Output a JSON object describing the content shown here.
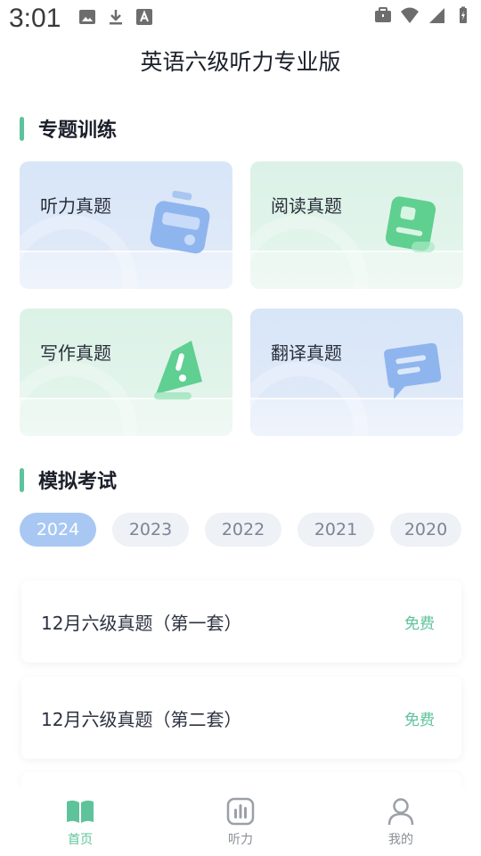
{
  "status": {
    "time": "3:01"
  },
  "app": {
    "title": "英语六级听力专业版"
  },
  "sections": {
    "topics": "专题训练",
    "mock": "模拟考试"
  },
  "cards": [
    {
      "label": "听力真题",
      "icon": "radio-icon",
      "theme": "blue"
    },
    {
      "label": "阅读真题",
      "icon": "reading-card-icon",
      "theme": "green"
    },
    {
      "label": "写作真题",
      "icon": "pen-exclamation-icon",
      "theme": "green"
    },
    {
      "label": "翻译真题",
      "icon": "chat-bubble-icon",
      "theme": "blue"
    }
  ],
  "years": {
    "items": [
      "2024",
      "2023",
      "2022",
      "2021",
      "2020"
    ],
    "selected": "2024"
  },
  "exams": [
    {
      "title": "12月六级真题（第一套）",
      "badge": "免费"
    },
    {
      "title": "12月六级真题（第二套）",
      "badge": "免费"
    }
  ],
  "tabs": [
    {
      "label": "首页",
      "icon": "book-icon",
      "active": true
    },
    {
      "label": "听力",
      "icon": "audio-bars-icon",
      "active": false
    },
    {
      "label": "我的",
      "icon": "person-icon",
      "active": false
    }
  ],
  "colors": {
    "accent": "#5ec39b",
    "year_active": "#a8c8f3",
    "card_blue": "#d8e6f8",
    "card_green": "#dcf2e7"
  }
}
